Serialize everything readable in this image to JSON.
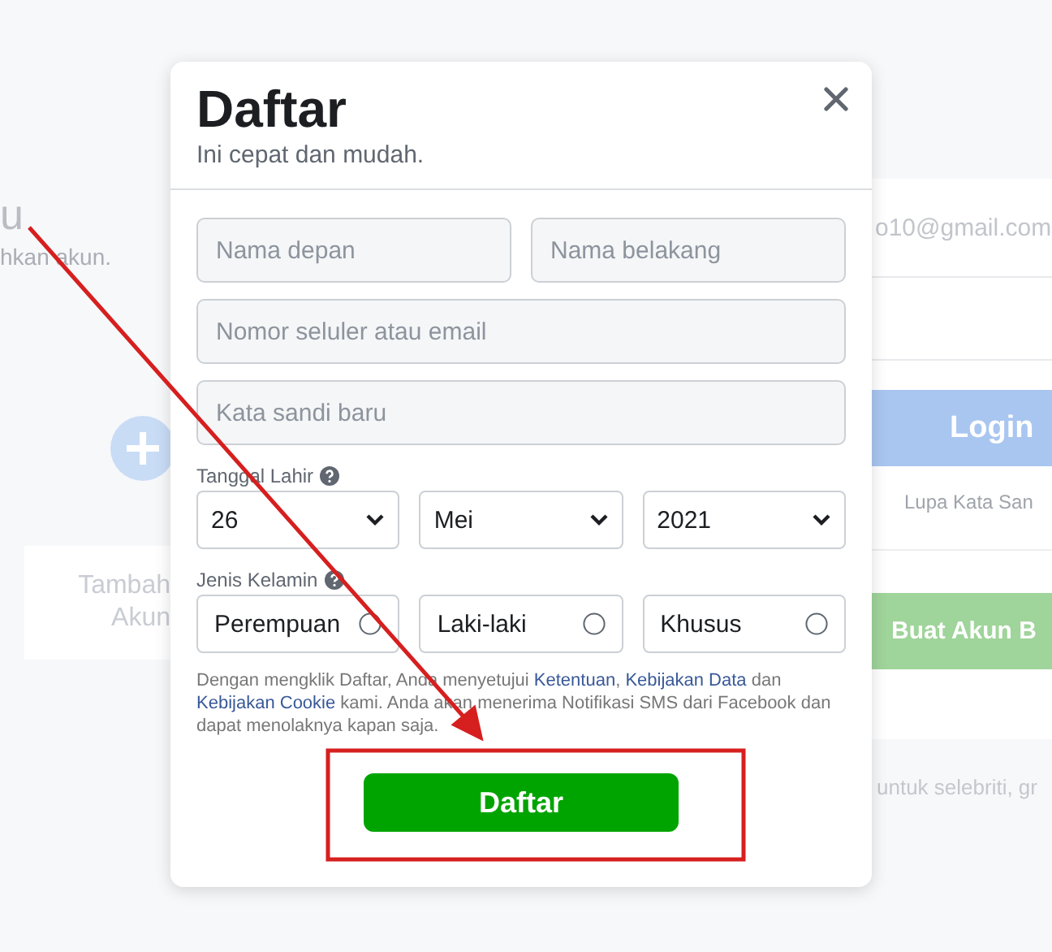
{
  "background": {
    "heading_fragment": "u",
    "subtitle_fragment": "hkan akun.",
    "add_account": {
      "label_lines": [
        "Tambah",
        "Akun"
      ]
    },
    "login_form": {
      "email_value": "o10@gmail.com",
      "login_button": "Login",
      "forgot_link": "Lupa Kata San",
      "create_button": "Buat Akun B",
      "footer_fragment": "untuk selebriti, gr"
    }
  },
  "dialog": {
    "title": "Daftar",
    "subtitle": "Ini cepat dan mudah.",
    "name_fields": [
      {
        "placeholder": "Nama depan"
      },
      {
        "placeholder": "Nama belakang"
      }
    ],
    "contact_field": {
      "placeholder": "Nomor seluler atau email"
    },
    "password_field": {
      "placeholder": "Kata sandi baru"
    },
    "birthday": {
      "label": "Tanggal Lahir",
      "selects": [
        "26",
        "Mei",
        "2021"
      ]
    },
    "gender": {
      "label": "Jenis Kelamin",
      "options": [
        {
          "label": "Perempuan",
          "selected": false
        },
        {
          "label": "Laki-laki",
          "selected": false
        },
        {
          "label": "Khusus",
          "selected": false
        }
      ]
    },
    "terms": [
      {
        "text": "Dengan mengklik Daftar, Anda menyetujui ",
        "link": false
      },
      {
        "text": "Ketentuan",
        "link": true
      },
      {
        "text": ", ",
        "link": false
      },
      {
        "text": "Kebijakan Data",
        "link": true
      },
      {
        "text": " dan ",
        "link": false
      },
      {
        "text": "Kebijakan Cookie",
        "link": true
      },
      {
        "text": " kami. Anda akan menerima Notifikasi SMS dari Facebook dan dapat menolaknya kapan saja.",
        "link": false
      }
    ],
    "submit": "Daftar",
    "submit_highlighted": true
  },
  "pointer_arrow": true
}
